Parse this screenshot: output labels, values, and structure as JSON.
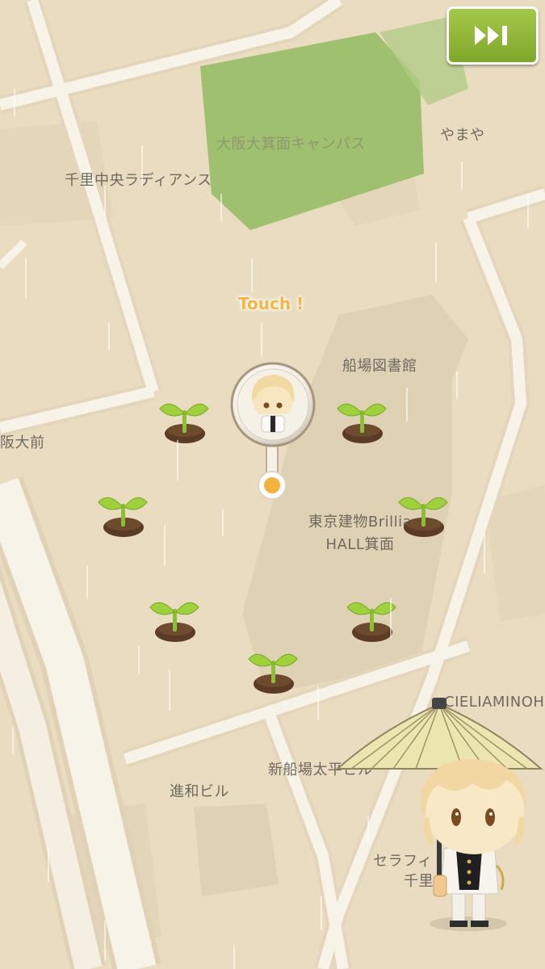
{
  "map": {
    "labels": {
      "campus": "大阪大箕面キャンパス",
      "yamaya": "やまや",
      "senri_radiance": "千里中央ラディアンス",
      "station": "阪大前",
      "library": "船場図書館",
      "brillia_line1": "東京建物Brillia",
      "brillia_line2": "HALL箕面",
      "cielia": "CIELIAMINOH",
      "shinsenba": "新船場太平ビル",
      "shinwa": "進和ビル",
      "seraphy_line1": "セラフィ　　ト",
      "seraphy_line2": "千里"
    },
    "colors": {
      "land": "#e9dcc0",
      "road": "#f6f1e4",
      "park": "#9fc06f",
      "building": "#ddd0b3"
    }
  },
  "hud": {
    "touch_prompt": "Touch !",
    "skip_icon": "fast-forward-icon",
    "skip_color": "#8cb534"
  },
  "sprouts": [
    {
      "id": "sprout-1"
    },
    {
      "id": "sprout-2"
    },
    {
      "id": "sprout-3"
    },
    {
      "id": "sprout-4"
    },
    {
      "id": "sprout-5"
    },
    {
      "id": "sprout-6"
    },
    {
      "id": "sprout-7"
    }
  ],
  "pin": {
    "icon": "character-location-pin-icon"
  },
  "mascot": {
    "icon": "character-with-umbrella-icon"
  }
}
